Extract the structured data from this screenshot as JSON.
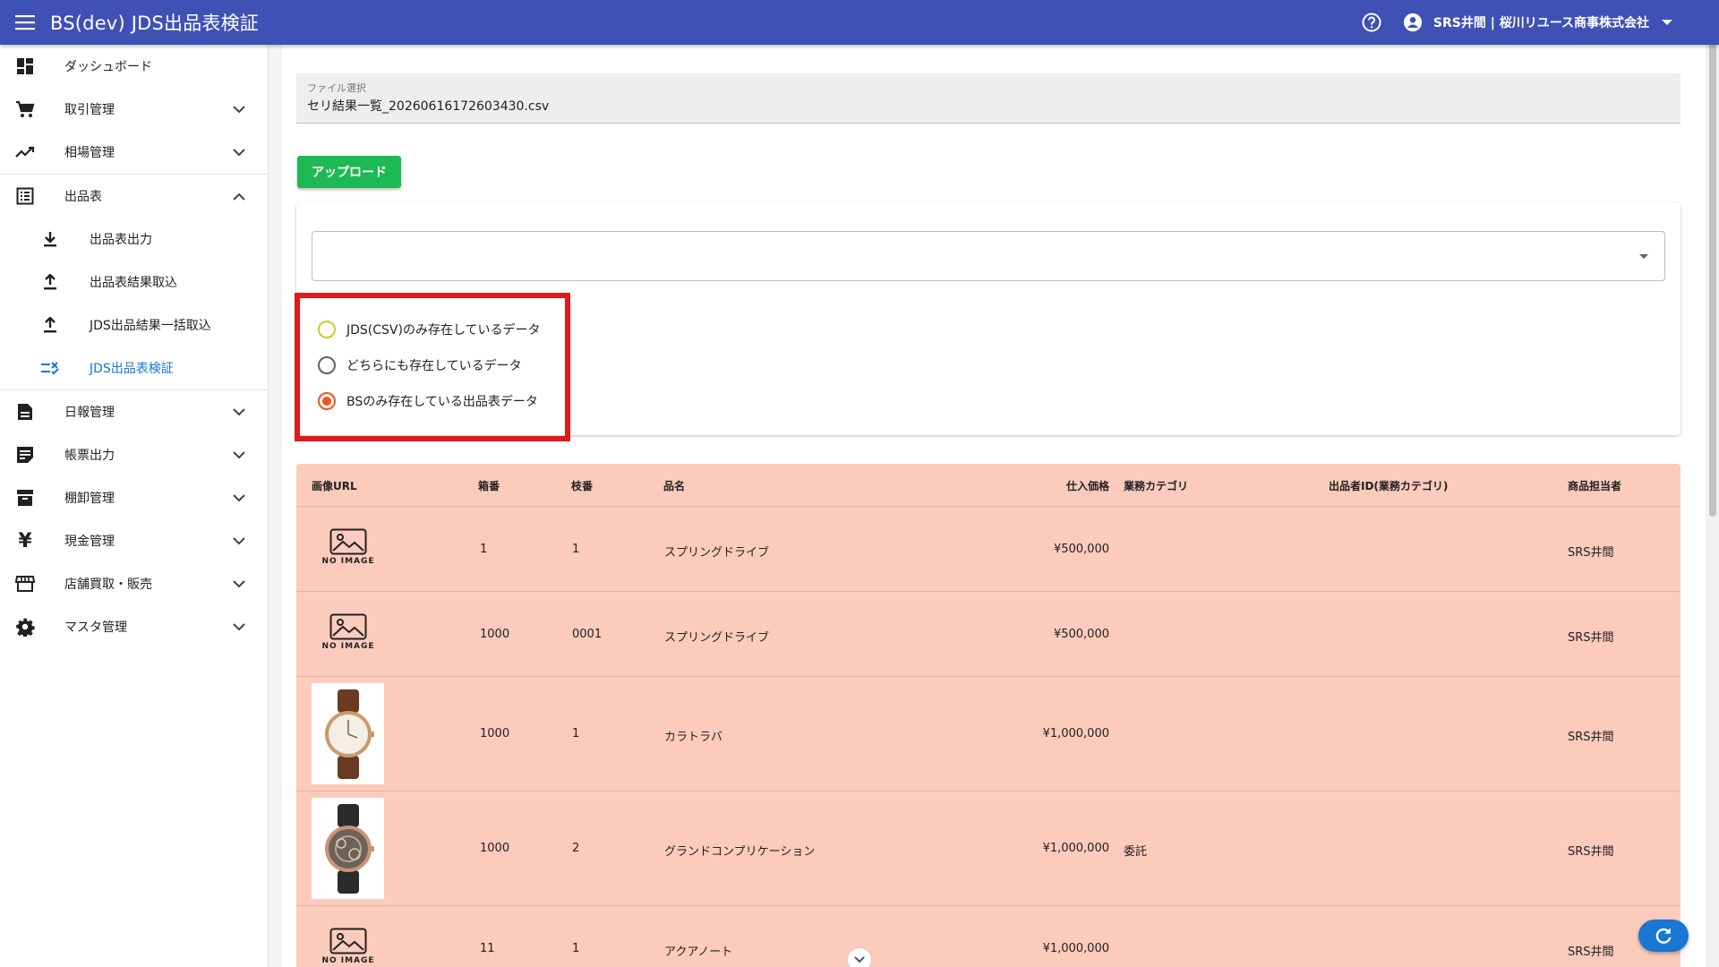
{
  "app": {
    "title": "BS(dev) JDS出品表検証",
    "user": "SRS井間 | 桜川リユース商事株式会社"
  },
  "sidebar": {
    "items": [
      {
        "label": "ダッシュボード"
      },
      {
        "label": "取引管理"
      },
      {
        "label": "相場管理"
      },
      {
        "label": "出品表"
      },
      {
        "label": "出品表出力"
      },
      {
        "label": "出品表結果取込"
      },
      {
        "label": "JDS出品結果一括取込"
      },
      {
        "label": "JDS出品表検証"
      },
      {
        "label": "日報管理"
      },
      {
        "label": "帳票出力"
      },
      {
        "label": "棚卸管理"
      },
      {
        "label": "現金管理"
      },
      {
        "label": "店舗買取・販売"
      },
      {
        "label": "マスタ管理"
      }
    ]
  },
  "main": {
    "file_caption": "ファイル選択",
    "file_value": "セリ結果一覧_20260616172603430.csv",
    "upload_label": "アップロード",
    "select_value": "",
    "radios": [
      {
        "label": "JDS(CSV)のみ存在しているデータ",
        "checked": false
      },
      {
        "label": "どちらにも存在しているデータ",
        "checked": false
      },
      {
        "label": "BSのみ存在している出品表データ",
        "checked": true
      }
    ]
  },
  "table": {
    "headers": [
      "画像URL",
      "箱番",
      "枝番",
      "品名",
      "仕入価格",
      "業務カテゴリ",
      "出品者ID(業務カテゴリ)",
      "商品担当者"
    ],
    "no_image_text": "NO IMAGE",
    "rows": [
      {
        "image": "no-image",
        "box": "1",
        "branch": "1",
        "name": "スプリングドライブ",
        "price": "¥500,000",
        "category": "",
        "seller_id": "",
        "staff": "SRS井間"
      },
      {
        "image": "no-image",
        "box": "1000",
        "branch": "0001",
        "name": "スプリングドライブ",
        "price": "¥500,000",
        "category": "",
        "seller_id": "",
        "staff": "SRS井間"
      },
      {
        "image": "watch-brown",
        "box": "1000",
        "branch": "1",
        "name": "カラトラバ",
        "price": "¥1,000,000",
        "category": "",
        "seller_id": "",
        "staff": "SRS井間"
      },
      {
        "image": "watch-skeleton",
        "box": "1000",
        "branch": "2",
        "name": "グランドコンプリケーション",
        "price": "¥1,000,000",
        "category": "委託",
        "seller_id": "",
        "staff": "SRS井間"
      },
      {
        "image": "no-image",
        "box": "11",
        "branch": "1",
        "name": "アクアノート",
        "price": "¥1,000,000",
        "category": "",
        "seller_id": "",
        "staff": "SRS井間"
      }
    ]
  },
  "colors": {
    "appbar": "#3f51b5",
    "upload": "#1db954",
    "row_bg": "#fccbbb",
    "radio_checked": "#f4511e",
    "highlight": "#e01919",
    "active_nav": "#1976d2"
  }
}
